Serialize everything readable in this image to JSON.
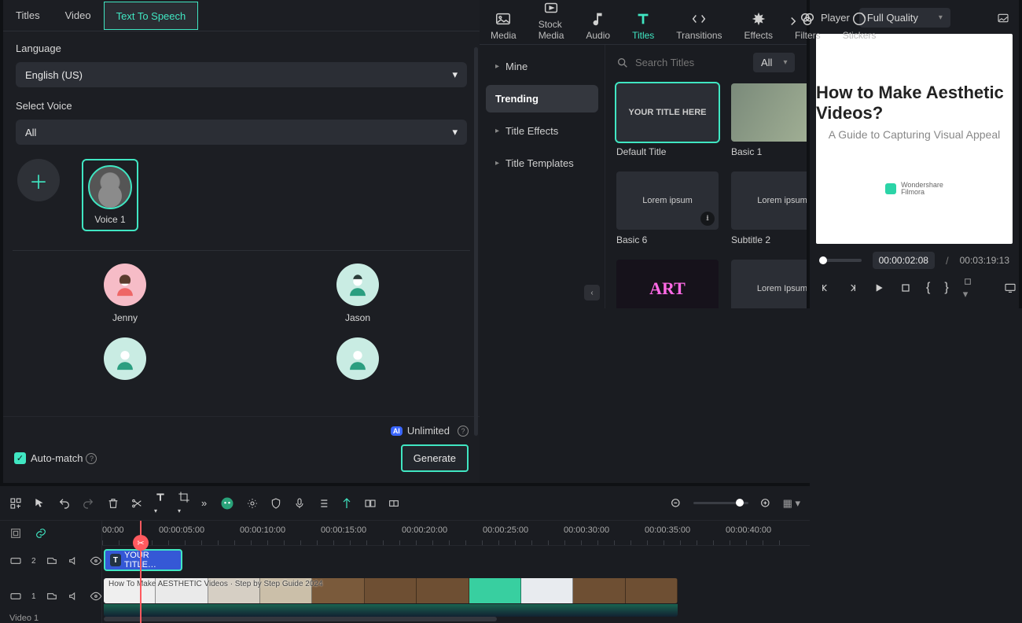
{
  "topTabs": [
    {
      "label": "Media"
    },
    {
      "label": "Stock Media"
    },
    {
      "label": "Audio"
    },
    {
      "label": "Titles",
      "active": true
    },
    {
      "label": "Transitions"
    },
    {
      "label": "Effects",
      "dot": true
    },
    {
      "label": "Filters"
    },
    {
      "label": "Stickers"
    }
  ],
  "sidebar": {
    "items": [
      {
        "label": "Mine"
      },
      {
        "label": "Trending",
        "active": true
      },
      {
        "label": "Title Effects"
      },
      {
        "label": "Title Templates"
      }
    ]
  },
  "search": {
    "placeholder": "Search Titles"
  },
  "filter": {
    "label": "All"
  },
  "tiles": [
    {
      "label": "Default Title",
      "overlay": "YOUR TITLE HERE",
      "selected": true
    },
    {
      "label": "Basic 1",
      "img": true
    },
    {
      "label": "Basic 6",
      "overlay": "Lorem ipsum",
      "dl": true
    },
    {
      "label": "Subtitle 2",
      "overlay": "Lorem ipsum",
      "dl": true
    },
    {
      "label": "",
      "overlay": "ART",
      "art": true,
      "dl": true
    },
    {
      "label": "",
      "overlay": "Lorem Ipsum",
      "dl": true
    }
  ],
  "preview": {
    "player_label": "Player",
    "quality": "Full Quality",
    "title": "How to Make Aesthetic Videos?",
    "subtitle": "A Guide to Capturing Visual Appeal",
    "watermark": "Wondershare\nFilmora",
    "current": "00:00:02:08",
    "sep": "/",
    "duration": "00:03:19:13"
  },
  "right": {
    "tabs": [
      {
        "label": "Titles"
      },
      {
        "label": "Video"
      },
      {
        "label": "Text To Speech",
        "active": true
      }
    ],
    "language_label": "Language",
    "language_value": "English (US)",
    "select_voice_label": "Select Voice",
    "voice_filter": "All",
    "custom_voice": "Voice 1",
    "presets": [
      {
        "name": "Jenny",
        "variant": "pink"
      },
      {
        "name": "Jason",
        "variant": "teal"
      },
      {
        "name": "",
        "variant": "teal"
      },
      {
        "name": "",
        "variant": "teal"
      }
    ],
    "unlimited": "Unlimited",
    "ai_badge": "AI",
    "auto_match": "Auto-match",
    "generate": "Generate"
  },
  "timeline": {
    "ruler": [
      "00:00",
      "00:00:05:00",
      "00:00:10:00",
      "00:00:15:00",
      "00:00:20:00",
      "00:00:25:00",
      "00:00:30:00",
      "00:00:35:00",
      "00:00:40:00"
    ],
    "track2_badge": "2",
    "track1_badge": "1",
    "video_track_name": "Video 1",
    "title_clip": "YOUR TITLE…",
    "video_clip_overlay": "How To Make AESTHETIC Videos · Step by Step Guide 2024"
  }
}
